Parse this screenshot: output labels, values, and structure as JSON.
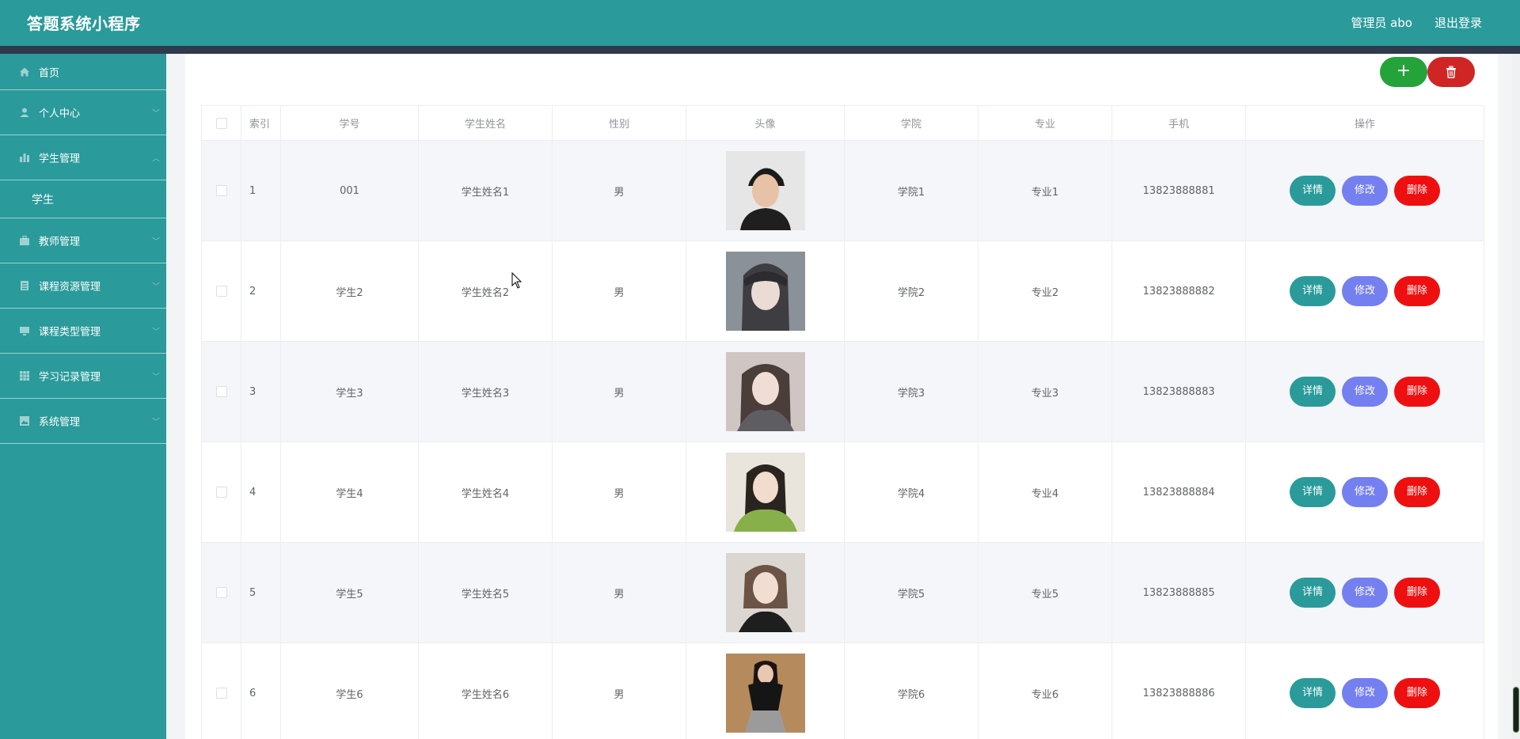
{
  "header": {
    "app_title": "答题系统小程序",
    "user_label": "管理员 abo",
    "logout_label": "退出登录"
  },
  "sidebar": {
    "items": [
      {
        "label": "首页",
        "icon": "home-icon"
      },
      {
        "label": "个人中心",
        "icon": "user-icon",
        "expandable": true
      },
      {
        "label": "学生管理",
        "icon": "chart-icon",
        "expandable": true,
        "expanded": true,
        "children": [
          "学生"
        ]
      },
      {
        "label": "教师管理",
        "icon": "briefcase-icon",
        "expandable": true
      },
      {
        "label": "课程资源管理",
        "icon": "list-icon",
        "expandable": true
      },
      {
        "label": "课程类型管理",
        "icon": "monitor-icon",
        "expandable": true
      },
      {
        "label": "学习记录管理",
        "icon": "grid-icon",
        "expandable": true
      },
      {
        "label": "系统管理",
        "icon": "image-icon",
        "expandable": true
      }
    ]
  },
  "toolbar": {
    "add_label": "+"
  },
  "table": {
    "headers": [
      "索引",
      "学号",
      "学生姓名",
      "性别",
      "头像",
      "学院",
      "专业",
      "手机",
      "操作"
    ],
    "rows": [
      {
        "index": "1",
        "student_no": "001",
        "name": "学生姓名1",
        "gender": "男",
        "college": "学院1",
        "major": "专业1",
        "phone": "13823888881"
      },
      {
        "index": "2",
        "student_no": "学生2",
        "name": "学生姓名2",
        "gender": "男",
        "college": "学院2",
        "major": "专业2",
        "phone": "13823888882"
      },
      {
        "index": "3",
        "student_no": "学生3",
        "name": "学生姓名3",
        "gender": "男",
        "college": "学院3",
        "major": "专业3",
        "phone": "13823888883"
      },
      {
        "index": "4",
        "student_no": "学生4",
        "name": "学生姓名4",
        "gender": "男",
        "college": "学院4",
        "major": "专业4",
        "phone": "13823888884"
      },
      {
        "index": "5",
        "student_no": "学生5",
        "name": "学生姓名5",
        "gender": "男",
        "college": "学院5",
        "major": "专业5",
        "phone": "13823888885"
      },
      {
        "index": "6",
        "student_no": "学生6",
        "name": "学生姓名6",
        "gender": "男",
        "college": "学院6",
        "major": "专业6",
        "phone": "13823888886"
      }
    ],
    "actions": {
      "detail": "详情",
      "edit": "修改",
      "delete": "删除"
    }
  },
  "colors": {
    "brand": "#2a9a9a",
    "header_strip": "#303a4d",
    "add": "#24a33b",
    "delete_top": "#cf2525",
    "edit": "#7480f0",
    "delete": "#ee1010"
  }
}
